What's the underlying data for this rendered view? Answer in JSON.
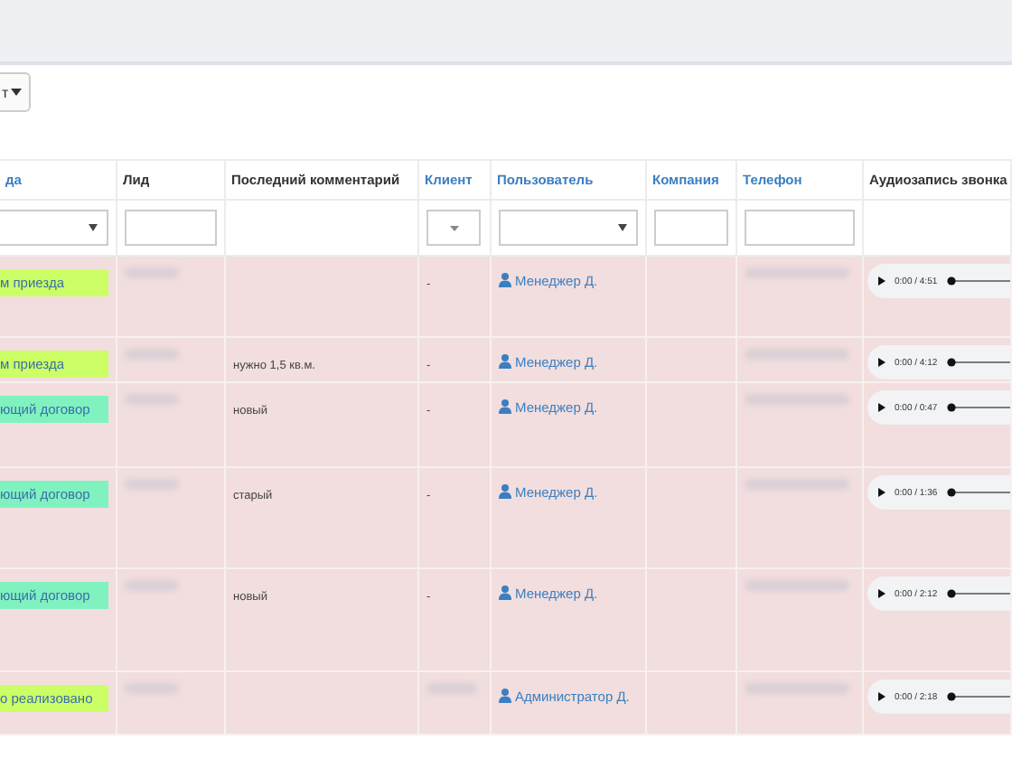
{
  "toolbar": {
    "dropdown_label": "т"
  },
  "table": {
    "columns": [
      {
        "label": "да",
        "sortable": true,
        "filter": {
          "kind": "select"
        }
      },
      {
        "label": "Лид",
        "sortable": false,
        "filter": {
          "kind": "input"
        }
      },
      {
        "label": "Последний комментарий",
        "sortable": false
      },
      {
        "label": "Клиент",
        "sortable": true,
        "filter": {
          "kind": "small-select"
        }
      },
      {
        "label": "Пользователь",
        "sortable": true,
        "filter": {
          "kind": "select"
        }
      },
      {
        "label": "Компания",
        "sortable": true,
        "filter": {
          "kind": "input"
        }
      },
      {
        "label": "Телефон",
        "sortable": true,
        "filter": {
          "kind": "input"
        }
      },
      {
        "label": "Аудиозапись звонка",
        "sortable": false
      }
    ],
    "rows": [
      {
        "status": "м приезда",
        "color": "#ccff66",
        "comment": "",
        "client": "-",
        "user": "Менеджер Д.",
        "audio_time": "0:00 / 4:51"
      },
      {
        "status": "м приезда",
        "color": "#ccff66",
        "comment": "нужно 1,5 кв.м.",
        "client": "-",
        "user": "Менеджер Д.",
        "audio_time": "0:00 / 4:12"
      },
      {
        "status": "ющий договор",
        "color": "#80f2c0",
        "comment": "новый",
        "client": "-",
        "user": "Менеджер Д.",
        "audio_time": "0:00 / 0:47"
      },
      {
        "status": "ющий договор",
        "color": "#80f2c0",
        "comment": "старый",
        "client": "-",
        "user": "Менеджер Д.",
        "audio_time": "0:00 / 1:36"
      },
      {
        "status": "ющий договор",
        "color": "#80f2c0",
        "comment": "новый",
        "client": "-",
        "user": "Менеджер Д.",
        "audio_time": "0:00 / 2:12"
      },
      {
        "status": "о реализовано",
        "color": "#ccff66",
        "comment": "",
        "user": "Администратор Д.",
        "audio_time": "0:00 / 2:18"
      }
    ]
  }
}
